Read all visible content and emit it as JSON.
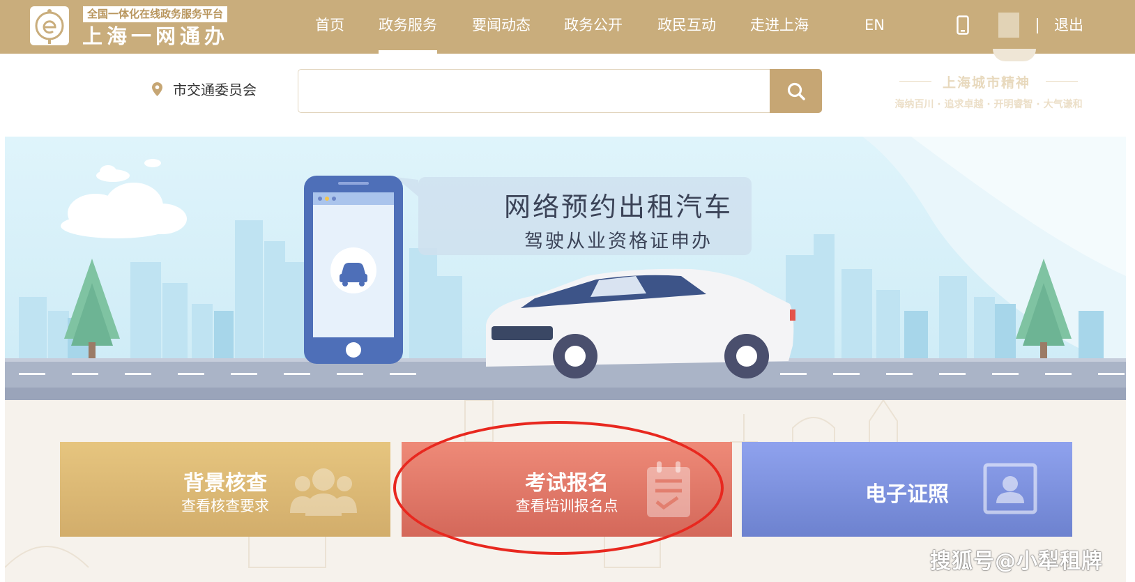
{
  "header": {
    "tagline": "全国一体化在线政务服务平台",
    "brand": "上海一网通办",
    "nav": [
      "首页",
      "政务服务",
      "要闻动态",
      "政务公开",
      "政民互动",
      "走进上海",
      "EN"
    ],
    "active_nav": "政务服务",
    "logout": "退出"
  },
  "search": {
    "location": "市交通委员会",
    "placeholder": "",
    "value": ""
  },
  "city_spirit": {
    "title": "上海城市精神",
    "subtitle": "海纳百川 · 追求卓越 · 开明睿智 · 大气谦和"
  },
  "banner": {
    "title": "网络预约出租汽车",
    "subtitle": "驾驶从业资格证申办"
  },
  "cards": [
    {
      "title": "背景核查",
      "subtitle": "查看核查要求",
      "icon": "people-icon",
      "color": "#d7b56f"
    },
    {
      "title": "考试报名",
      "subtitle": "查看培训报名点",
      "icon": "clipboard-check-icon",
      "color": "#e07a68"
    },
    {
      "title": "电子证照",
      "subtitle": "",
      "icon": "id-card-icon",
      "color": "#7f92dc"
    }
  ],
  "watermark": "搜狐号@小犁租牌",
  "colors": {
    "header_bg": "#c9ad7c",
    "search_button": "#c6a674",
    "annotation_red": "#e8281f"
  }
}
